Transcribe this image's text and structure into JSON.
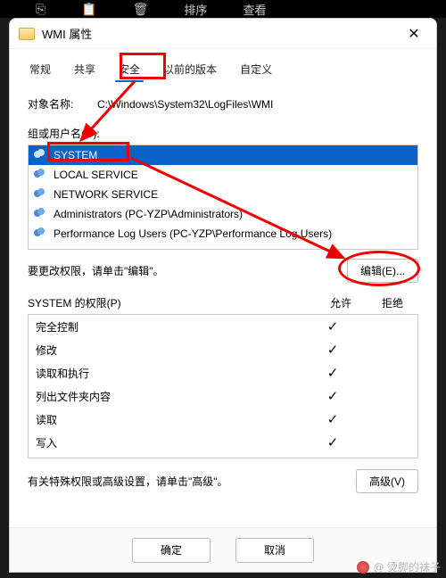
{
  "topbar": {
    "sort_label": "排序",
    "view_label": "查看"
  },
  "titlebar": {
    "title": "WMI 属性"
  },
  "tabs": {
    "general": "常规",
    "share": "共享",
    "security": "安全",
    "previous": "以前的版本",
    "custom": "自定义"
  },
  "object": {
    "label": "对象名称:",
    "path": "C:\\Windows\\System32\\LogFiles\\WMI"
  },
  "groups": {
    "label": "组或用户名(G):",
    "items": [
      {
        "name": "SYSTEM"
      },
      {
        "name": "LOCAL SERVICE"
      },
      {
        "name": "NETWORK SERVICE"
      },
      {
        "name": "Administrators (PC-YZP\\Administrators)"
      },
      {
        "name": "Performance Log Users (PC-YZP\\Performance Log Users)"
      }
    ]
  },
  "editrow": {
    "text": "要更改权限，请单击\"编辑\"。",
    "button": "编辑(E)..."
  },
  "perm": {
    "header": "SYSTEM 的权限(P)",
    "allow": "允许",
    "deny": "拒绝",
    "rows": [
      {
        "name": "完全控制",
        "allow": true
      },
      {
        "name": "修改",
        "allow": true
      },
      {
        "name": "读取和执行",
        "allow": true
      },
      {
        "name": "列出文件夹内容",
        "allow": true
      },
      {
        "name": "读取",
        "allow": true
      },
      {
        "name": "写入",
        "allow": true
      }
    ]
  },
  "advrow": {
    "text": "有关特殊权限或高级设置，请单击\"高级\"。",
    "button": "高级(V)"
  },
  "buttons": {
    "ok": "确定",
    "cancel": "取消"
  },
  "watermark": "@ 烫脚的袜子"
}
